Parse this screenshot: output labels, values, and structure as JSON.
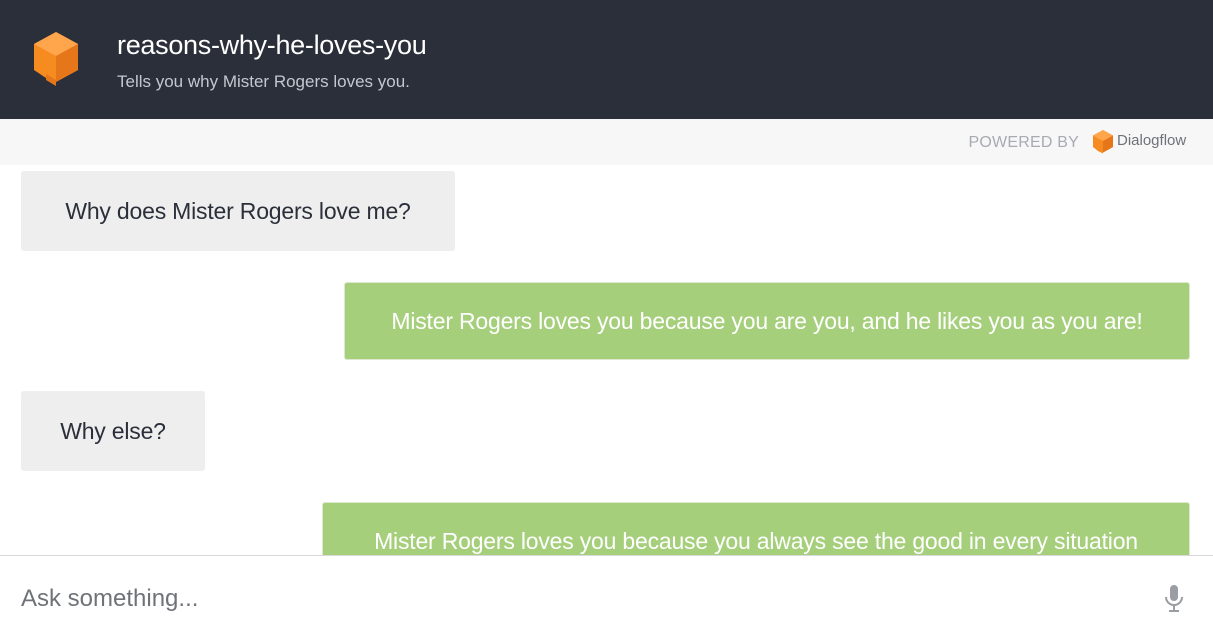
{
  "agent": {
    "name": "reasons-why-he-loves-you",
    "description": "Tells you why Mister Rogers loves you."
  },
  "powered_by": {
    "label": "POWERED BY",
    "brand": "Dialogflow"
  },
  "messages": [
    {
      "role": "user",
      "text": "Why does Mister Rogers love me?"
    },
    {
      "role": "bot",
      "text": "Mister Rogers loves you because you are you, and he likes you as you are!"
    },
    {
      "role": "user",
      "text": "Why else?"
    },
    {
      "role": "bot",
      "text": "Mister Rogers loves you because you always see the good in every situation"
    }
  ],
  "input": {
    "placeholder": "Ask something...",
    "value": ""
  },
  "icons": {
    "agent_logo": "dialogflow-cube-icon",
    "brand_logo": "dialogflow-logo-icon",
    "mic": "microphone-icon"
  },
  "colors": {
    "header_bg": "#2b2f3a",
    "bot_bubble": "#a6cf7c",
    "user_bubble": "#eeeeee",
    "brand_orange": "#f68b20"
  }
}
